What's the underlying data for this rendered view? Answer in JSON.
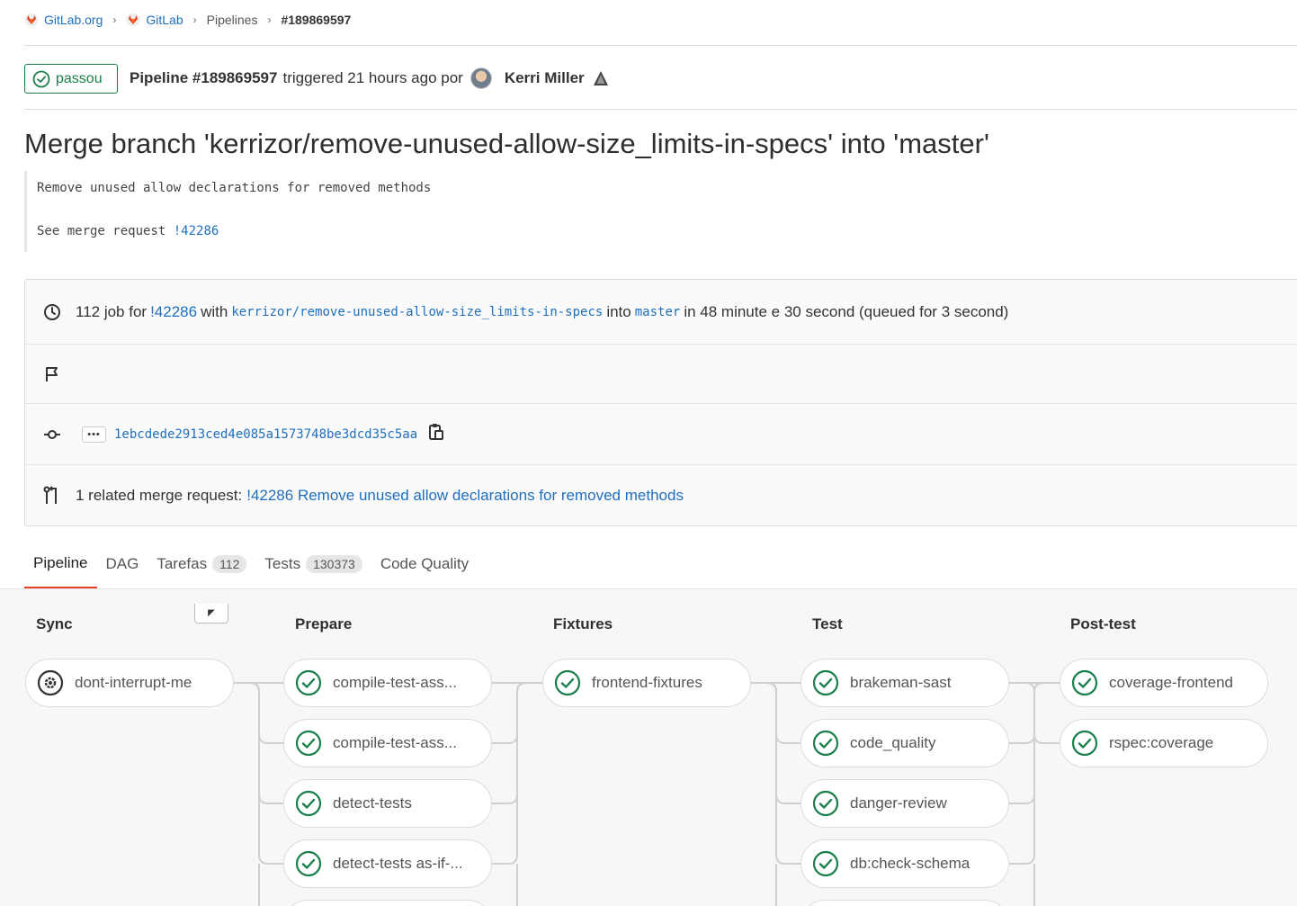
{
  "breadcrumb": {
    "items": [
      "GitLab.org",
      "GitLab",
      "Pipelines",
      "#189869597"
    ]
  },
  "header": {
    "status": "passou",
    "pipeline_id": "Pipeline #189869597",
    "triggered": "triggered 21 hours ago por",
    "author": "Kerri Miller"
  },
  "commit": {
    "title": "Merge branch 'kerrizor/remove-unused-allow-size_limits-in-specs' into 'master'",
    "desc_line1": "Remove unused allow declarations for removed methods",
    "desc_line2_prefix": "See merge request",
    "desc_line2_link": "!42286"
  },
  "info": {
    "jobs_count": "112 job for",
    "mr_link": "!42286",
    "with": "with",
    "branch": "kerrizor/remove-unused-allow-size_limits-in-specs",
    "into": "into",
    "target": "master",
    "duration": "in 48 minute e 30 second (queued for 3 second)",
    "ellipsis": "•••",
    "sha": "1ebcdede2913ced4e085a1573748be3dcd35c5aa",
    "related_prefix": "1 related merge request:",
    "related_link": "!42286 Remove unused allow declarations for removed methods"
  },
  "tabs": {
    "pipeline": "Pipeline",
    "dag": "DAG",
    "tarefas": "Tarefas",
    "tarefas_count": "112",
    "tests": "Tests",
    "tests_count": "130373",
    "code_quality": "Code Quality"
  },
  "colors": {
    "success": "#1a7f4b",
    "link": "#1f6fbf",
    "tab_active": "#e24329"
  },
  "stages": [
    {
      "name": "Sync",
      "jobs": [
        {
          "name": "dont-interrupt-me",
          "status": "manual"
        }
      ]
    },
    {
      "name": "Prepare",
      "jobs": [
        {
          "name": "compile-test-ass...",
          "status": "success"
        },
        {
          "name": "compile-test-ass...",
          "status": "success"
        },
        {
          "name": "detect-tests",
          "status": "success"
        },
        {
          "name": "detect-tests as-if-...",
          "status": "success"
        }
      ]
    },
    {
      "name": "Fixtures",
      "jobs": [
        {
          "name": "frontend-fixtures",
          "status": "success"
        }
      ]
    },
    {
      "name": "Test",
      "jobs": [
        {
          "name": "brakeman-sast",
          "status": "success"
        },
        {
          "name": "code_quality",
          "status": "success"
        },
        {
          "name": "danger-review",
          "status": "success"
        },
        {
          "name": "db:check-schema",
          "status": "success"
        }
      ]
    },
    {
      "name": "Post-test",
      "jobs": [
        {
          "name": "coverage-frontend",
          "status": "success"
        },
        {
          "name": "rspec:coverage",
          "status": "success"
        }
      ]
    }
  ]
}
